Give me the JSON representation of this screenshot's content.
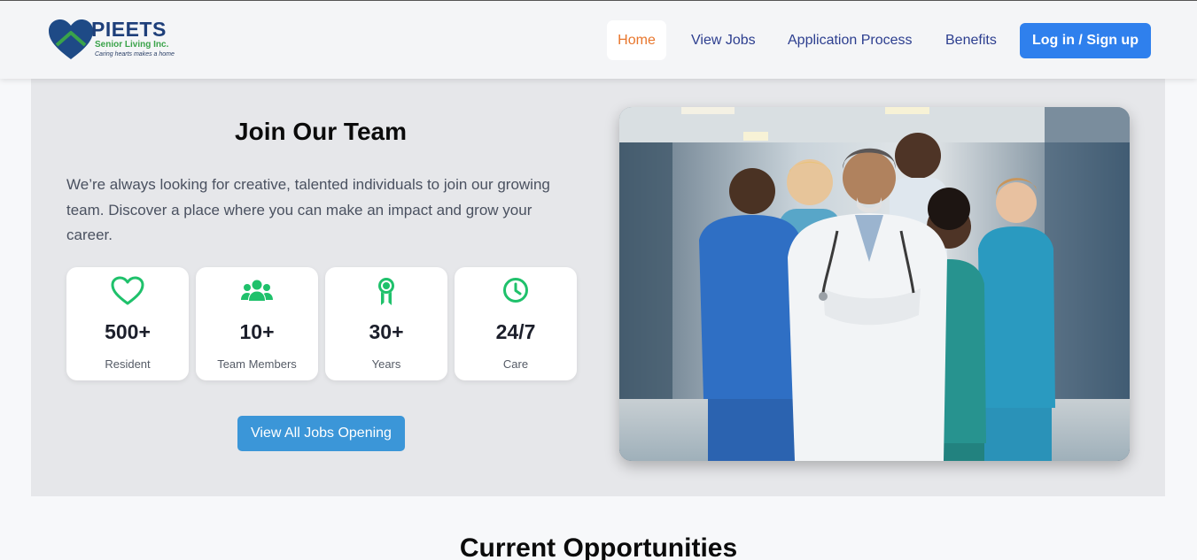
{
  "header": {
    "logo": {
      "brand": "PIEETS",
      "subtitle": "Senior Living Inc.",
      "tagline": "Caring hearts makes a home"
    },
    "nav": [
      {
        "label": "Home",
        "active": true
      },
      {
        "label": "View Jobs"
      },
      {
        "label": "Application Process"
      },
      {
        "label": "Benefits"
      }
    ],
    "login_label": "Log in / Sign up"
  },
  "hero": {
    "title": "Join Our Team",
    "description": "We’re always looking for creative, talented individuals to join our growing team. Discover a place where you can make an impact and grow your career.",
    "stats": [
      {
        "icon": "heart-icon",
        "value": "500+",
        "label": "Resident"
      },
      {
        "icon": "users-icon",
        "value": "10+",
        "label": "Team Members"
      },
      {
        "icon": "award-icon",
        "value": "30+",
        "label": "Years"
      },
      {
        "icon": "clock-icon",
        "value": "24/7",
        "label": "Care"
      }
    ],
    "cta_label": "View All Jobs Opening",
    "image": "team-of-healthcare-workers-photo"
  },
  "sections": {
    "opportunities_title": "Current Opportunities"
  },
  "colors": {
    "accent": "#2f80ed",
    "nav_active": "#e8762c",
    "nav_text": "#2c3e8f",
    "icon_green": "#1fc16b",
    "cta": "#3b96d8",
    "brand_navy": "#1e3f7a",
    "brand_green": "#3aa34a"
  }
}
